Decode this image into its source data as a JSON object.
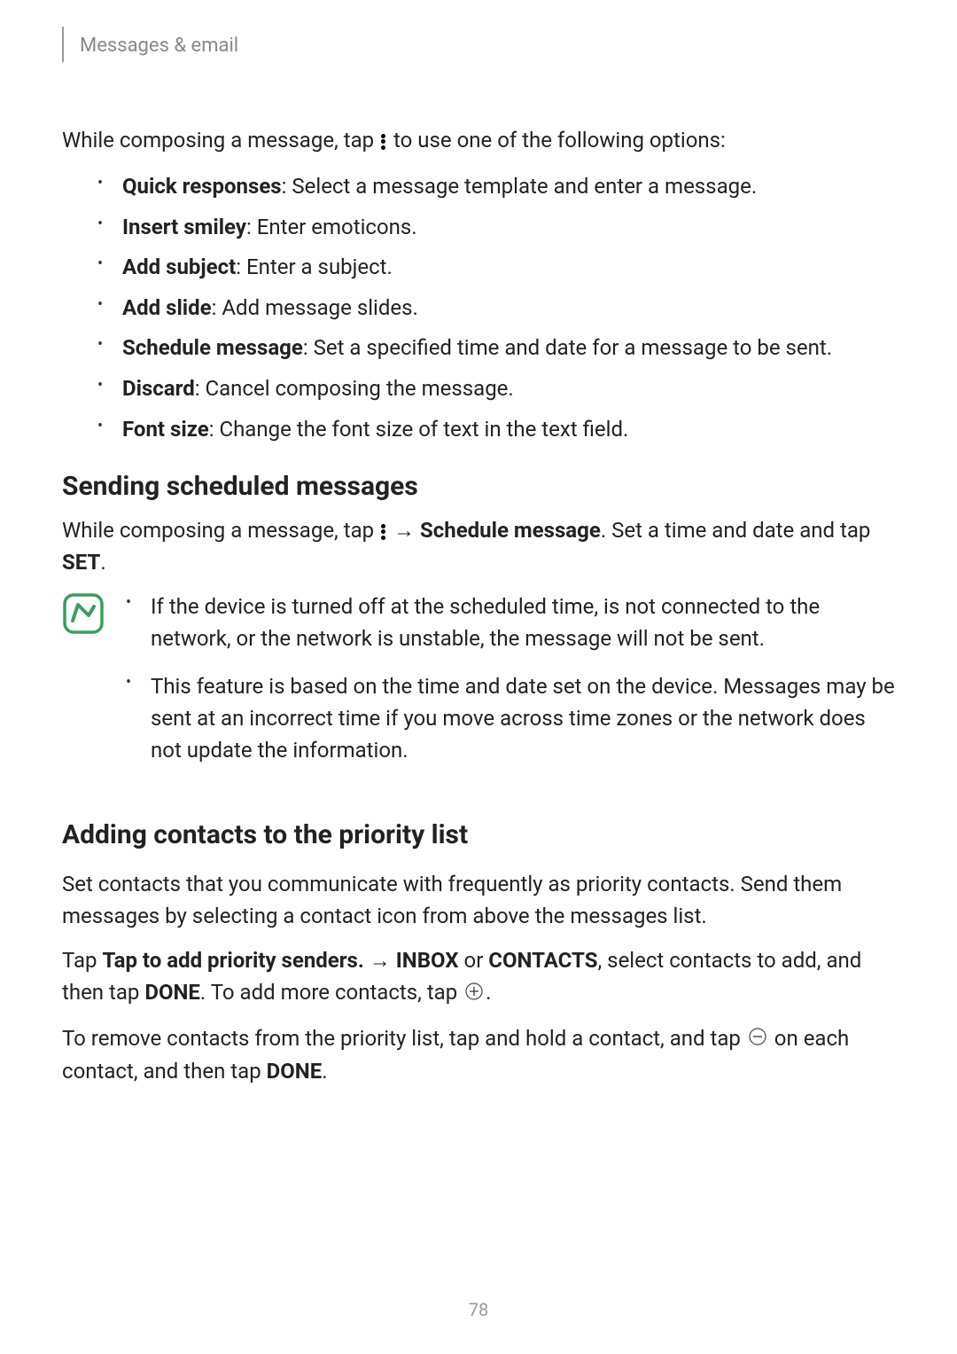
{
  "header": {
    "title": "Messages & email"
  },
  "intro": {
    "text_before": "While composing a message, tap ",
    "text_after": " to use one of the following options:"
  },
  "options": [
    {
      "label": "Quick responses",
      "desc": ": Select a message template and enter a message."
    },
    {
      "label": "Insert smiley",
      "desc": ": Enter emoticons."
    },
    {
      "label": "Add subject",
      "desc": ": Enter a subject."
    },
    {
      "label": "Add slide",
      "desc": ": Add message slides."
    },
    {
      "label": "Schedule message",
      "desc": ": Set a specified time and date for a message to be sent."
    },
    {
      "label": "Discard",
      "desc": ": Cancel composing the message."
    },
    {
      "label": "Font size",
      "desc": ": Change the font size of text in the text field."
    }
  ],
  "section1": {
    "heading": "Sending scheduled messages",
    "para_before": "While composing a message, tap ",
    "arrow": " → ",
    "schedule_label": "Schedule message",
    "para_mid": ". Set a time and date and tap ",
    "set_label": "SET",
    "para_end": ".",
    "notes": [
      "If the device is turned off at the scheduled time, is not connected to the network, or the network is unstable, the message will not be sent.",
      "This feature is based on the time and date set on the device. Messages may be sent at an incorrect time if you move across time zones or the network does not update the information."
    ]
  },
  "section2": {
    "heading": "Adding contacts to the priority list",
    "para1": "Set contacts that you communicate with frequently as priority contacts. Send them messages by selecting a contact icon from above the messages list.",
    "para2_before": "Tap ",
    "tap_priority": "Tap to add priority senders.",
    "arrow": " → ",
    "inbox": "INBOX",
    "or": " or ",
    "contacts": "CONTACTS",
    "para2_mid": ", select contacts to add, and then tap ",
    "done": "DONE",
    "para2_end1": ". To add more contacts, tap ",
    "para2_end2": ".",
    "para3_before": "To remove contacts from the priority list, tap and hold a contact, and tap ",
    "para3_mid": " on each contact, and then tap ",
    "para3_end": "."
  },
  "page_number": "78"
}
